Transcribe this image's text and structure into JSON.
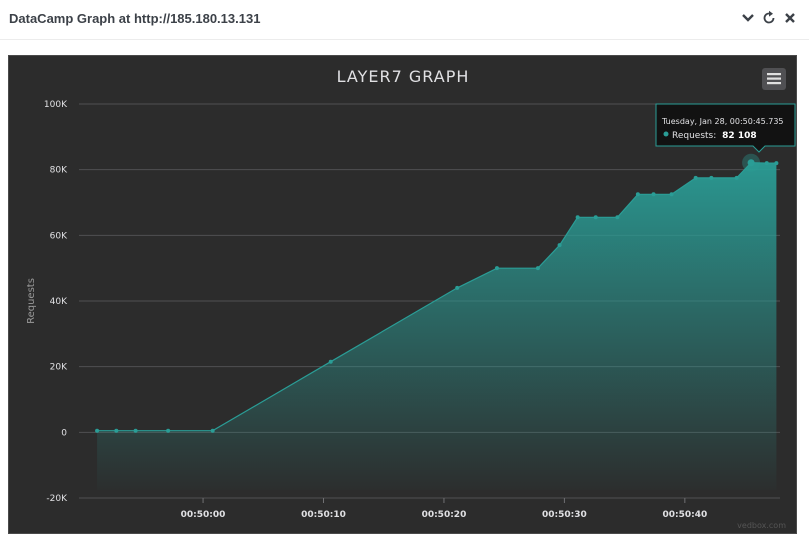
{
  "window": {
    "title": "DataCamp Graph at http://185.180.13.131",
    "icons": [
      "chevron-down-icon",
      "refresh-icon",
      "close-icon"
    ]
  },
  "chart_data": {
    "type": "area",
    "title": "LAYER7 GRAPH",
    "xlabel": "",
    "ylabel": "Requests",
    "ylim": [
      -20000,
      100000
    ],
    "yticks": [
      -20000,
      0,
      20000,
      40000,
      60000,
      80000,
      100000
    ],
    "ytick_labels": [
      "-20K",
      "0",
      "20K",
      "40K",
      "60K",
      "80K",
      "100K"
    ],
    "xticks": [
      0,
      10,
      20,
      30,
      40
    ],
    "xtick_labels": [
      "00:50:00",
      "00:50:10",
      "00:50:20",
      "00:50:30",
      "00:50:40"
    ],
    "x_unit": "seconds after 00:50:00",
    "series": [
      {
        "name": "Requests",
        "color": "#2a9d96",
        "x": [
          -8.8,
          -7.2,
          -5.6,
          -2.9,
          0.8,
          10.6,
          21.1,
          24.4,
          27.8,
          29.6,
          31.1,
          32.6,
          34.4,
          36.1,
          37.4,
          38.9,
          40.9,
          42.2,
          44.3,
          45.5,
          46.8,
          47.6
        ],
        "values": [
          500,
          500,
          500,
          500,
          500,
          21500,
          44000,
          50000,
          50000,
          57000,
          65500,
          65500,
          65500,
          72500,
          72500,
          72500,
          77500,
          77500,
          77500,
          82108,
          82000,
          82000
        ]
      }
    ],
    "tooltip": {
      "header": "Tuesday, Jan 28, 00:50:45.735",
      "series_name": "Requests:",
      "value": "82 108"
    },
    "grid": true,
    "legend": "none",
    "credit": "vedbox.com",
    "background": "#2c2c2c",
    "menu_icon": "hamburger-menu-icon"
  }
}
